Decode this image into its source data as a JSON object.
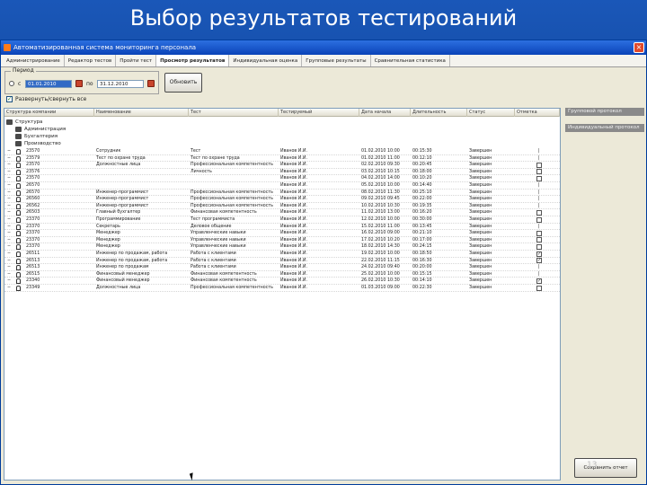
{
  "slide": {
    "title": "Выбор результатов тестирований"
  },
  "window": {
    "title": "Автоматизированная система мониторинга персонала"
  },
  "tabs": [
    {
      "label": "Администрирование"
    },
    {
      "label": "Редактор тестов"
    },
    {
      "label": "Пройти тест"
    },
    {
      "label": "Просмотр результатов"
    },
    {
      "label": "Индивидуальная оценка"
    },
    {
      "label": "Групповые результаты"
    },
    {
      "label": "Сравнительная статистика"
    }
  ],
  "filter": {
    "legend": "Период",
    "from_label": "с",
    "to_label": "по",
    "from_value": "01.01.2010",
    "to_value": "31.12.2010",
    "refresh_label": "Обновить"
  },
  "check_row": {
    "label": "Развернуть/свернуть все"
  },
  "columns": [
    "Структура компании",
    "Наименование",
    "Тест",
    "Тестируемый",
    "Дата начала",
    "Длительность",
    "Статус",
    "Отметка"
  ],
  "tree": {
    "root": "Структура",
    "nodes": [
      "Администрация",
      "Бухгалтерия",
      "Производство"
    ]
  },
  "rows": [
    {
      "id": "23570",
      "name": "Сотрудник",
      "test": "Тест",
      "person": "Иванов И.И.",
      "date": "01.02.2010 10:00",
      "dur": "00:15:30",
      "status": "Завершен",
      "mark": "none"
    },
    {
      "id": "23579",
      "name": "Тест по охране труда",
      "test": "Тест по охране труда",
      "person": "Иванов И.И.",
      "date": "01.02.2010 11:00",
      "dur": "00:12:10",
      "status": "Завершен",
      "mark": "none"
    },
    {
      "id": "23570",
      "name": "Должностные лица",
      "test": "Профессиональная компетентность",
      "person": "Иванов И.И.",
      "date": "02.02.2010 09:30",
      "dur": "00:20:45",
      "status": "Завершен",
      "mark": "unchecked"
    },
    {
      "id": "23576",
      "name": "",
      "test": "Личность",
      "person": "Иванов И.И.",
      "date": "03.02.2010 10:15",
      "dur": "00:18:00",
      "status": "Завершен",
      "mark": "unchecked"
    },
    {
      "id": "23570",
      "name": "",
      "test": "",
      "person": "Иванов И.И.",
      "date": "04.02.2010 14:00",
      "dur": "00:10:20",
      "status": "Завершен",
      "mark": "unchecked"
    },
    {
      "id": "26570",
      "name": "",
      "test": "",
      "person": "Иванов И.И.",
      "date": "05.02.2010 10:00",
      "dur": "00:14:40",
      "status": "Завершен",
      "mark": "none"
    },
    {
      "id": "26570",
      "name": "Инженер-программист",
      "test": "Профессиональная компетентность",
      "person": "Иванов И.И.",
      "date": "08.02.2010 11:30",
      "dur": "00:25:10",
      "status": "Завершен",
      "mark": "none"
    },
    {
      "id": "26560",
      "name": "Инженер-программист",
      "test": "Профессиональная компетентность",
      "person": "Иванов И.И.",
      "date": "09.02.2010 09:45",
      "dur": "00:22:00",
      "status": "Завершен",
      "mark": "none"
    },
    {
      "id": "26562",
      "name": "Инженер-программист",
      "test": "Профессиональная компетентность",
      "person": "Иванов И.И.",
      "date": "10.02.2010 10:30",
      "dur": "00:19:35",
      "status": "Завершен",
      "mark": "none"
    },
    {
      "id": "26503",
      "name": "Главный бухгалтер",
      "test": "Финансовая компетентность",
      "person": "Иванов И.И.",
      "date": "11.02.2010 13:00",
      "dur": "00:16:20",
      "status": "Завершен",
      "mark": "unchecked"
    },
    {
      "id": "23370",
      "name": "Программирование",
      "test": "Тест программиста",
      "person": "Иванов И.И.",
      "date": "12.02.2010 10:00",
      "dur": "00:30:00",
      "status": "Завершен",
      "mark": "unchecked"
    },
    {
      "id": "23370",
      "name": "Секретарь",
      "test": "Деловое общение",
      "person": "Иванов И.И.",
      "date": "15.02.2010 11:00",
      "dur": "00:13:45",
      "status": "Завершен",
      "mark": "none"
    },
    {
      "id": "23370",
      "name": "Менеджер",
      "test": "Управленческие навыки",
      "person": "Иванов И.И.",
      "date": "16.02.2010 09:00",
      "dur": "00:21:10",
      "status": "Завершен",
      "mark": "unchecked"
    },
    {
      "id": "23370",
      "name": "Менеджер",
      "test": "Управленческие навыки",
      "person": "Иванов И.И.",
      "date": "17.02.2010 10:20",
      "dur": "00:17:00",
      "status": "Завершен",
      "mark": "unchecked"
    },
    {
      "id": "23370",
      "name": "Менеджер",
      "test": "Управленческие навыки",
      "person": "Иванов И.И.",
      "date": "18.02.2010 14:30",
      "dur": "00:24:15",
      "status": "Завершен",
      "mark": "unchecked"
    },
    {
      "id": "26511",
      "name": "Инженер по продажам, работа",
      "test": "Работа с клиентами",
      "person": "Иванов И.И.",
      "date": "19.02.2010 10:00",
      "dur": "00:18:50",
      "status": "Завершен",
      "mark": "checked"
    },
    {
      "id": "26513",
      "name": "Инженер по продажам, работа",
      "test": "Работа с клиентами",
      "person": "Иванов И.И.",
      "date": "22.02.2010 11:15",
      "dur": "00:16:30",
      "status": "Завершен",
      "mark": "checked"
    },
    {
      "id": "26513",
      "name": "Инженер по продажам",
      "test": "Работа с клиентами",
      "person": "Иванов И.И.",
      "date": "24.02.2010 09:40",
      "dur": "00:20:00",
      "status": "Завершен",
      "mark": "none"
    },
    {
      "id": "26515",
      "name": "Финансовый менеджер",
      "test": "Финансовая компетентность",
      "person": "Иванов И.И.",
      "date": "25.02.2010 10:00",
      "dur": "00:15:15",
      "status": "Завершен",
      "mark": "none"
    },
    {
      "id": "23340",
      "name": "Финансовый менеджер",
      "test": "Финансовая компетентность",
      "person": "Иванов И.И.",
      "date": "26.02.2010 10:30",
      "dur": "00:14:10",
      "status": "Завершен",
      "mark": "checked"
    },
    {
      "id": "23349",
      "name": "Должностные лица",
      "test": "Профессиональная компетентность",
      "person": "Иванов И.И.",
      "date": "01.03.2010 09:00",
      "dur": "00:22:30",
      "status": "Завершен",
      "mark": "unchecked"
    }
  ],
  "side_buttons": [
    {
      "label": "Групповой протокол"
    },
    {
      "label": "Индивидуальный протокол"
    }
  ],
  "footer": {
    "button_label": "Сохранить отчет",
    "page_number": "13"
  }
}
